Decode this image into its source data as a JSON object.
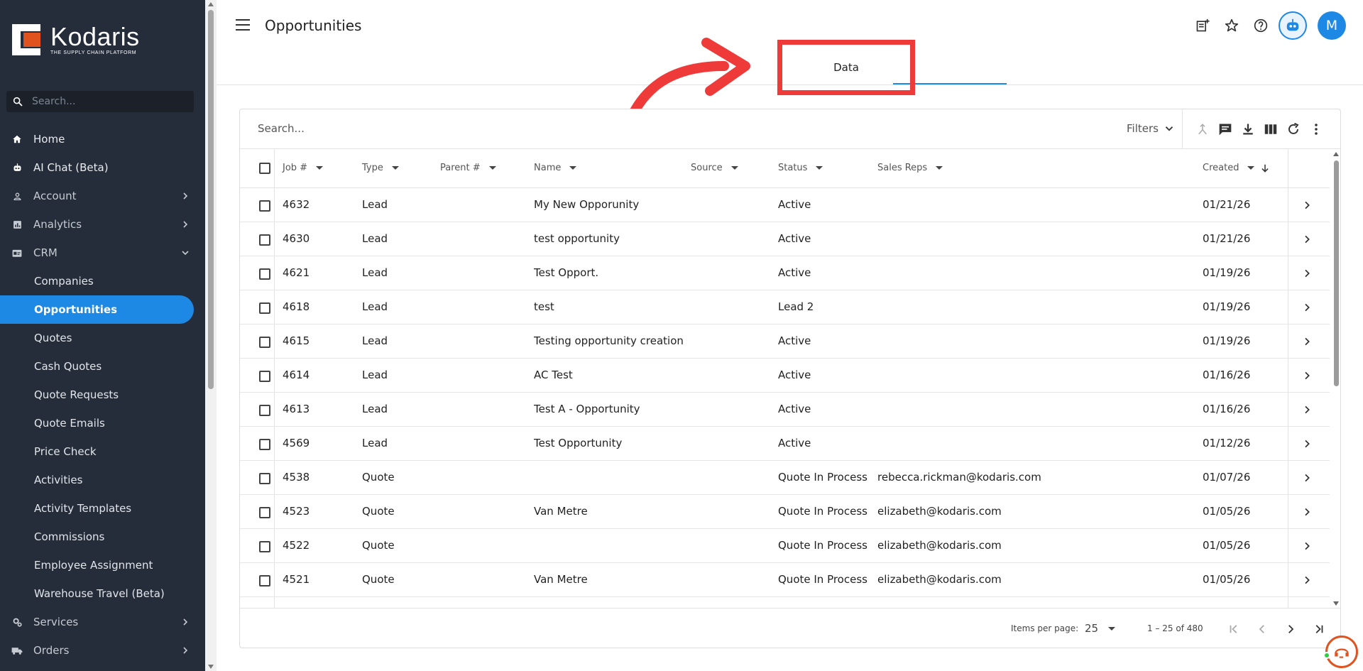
{
  "brand": {
    "name": "Kodaris",
    "tagline": "THE SUPPLY CHAIN PLATFORM",
    "accent": "#e0531f"
  },
  "sidebar": {
    "search_placeholder": "Search...",
    "items": [
      {
        "label": "Home",
        "icon": "home-icon"
      },
      {
        "label": "AI Chat (Beta)",
        "icon": "robot-icon"
      },
      {
        "label": "Account",
        "icon": "person-icon"
      },
      {
        "label": "Analytics",
        "icon": "chart-icon"
      },
      {
        "label": "CRM",
        "icon": "id-card-icon"
      }
    ],
    "crm_sub": [
      {
        "label": "Companies"
      },
      {
        "label": "Opportunities"
      },
      {
        "label": "Quotes"
      },
      {
        "label": "Cash Quotes"
      },
      {
        "label": "Quote Requests"
      },
      {
        "label": "Quote Emails"
      },
      {
        "label": "Price Check"
      },
      {
        "label": "Activities"
      },
      {
        "label": "Activity Templates"
      },
      {
        "label": "Commissions"
      },
      {
        "label": "Employee Assignment"
      },
      {
        "label": "Warehouse Travel (Beta)"
      }
    ],
    "bottom": [
      {
        "label": "Services",
        "icon": "gears-icon"
      },
      {
        "label": "Orders",
        "icon": "truck-icon"
      }
    ]
  },
  "header": {
    "title": "Opportunities",
    "avatar_initial": "M"
  },
  "tabs": {
    "data_label": "Data"
  },
  "toolbar": {
    "search_placeholder": "Search...",
    "filters_label": "Filters"
  },
  "table": {
    "columns": [
      "Job #",
      "Type",
      "Parent #",
      "Name",
      "Source",
      "Status",
      "Sales Reps",
      "Created"
    ],
    "rows": [
      {
        "job": "4632",
        "type": "Lead",
        "parent": "",
        "name": "My New Opporunity",
        "source": "",
        "status": "Active",
        "reps": "",
        "created": "01/21/26"
      },
      {
        "job": "4630",
        "type": "Lead",
        "parent": "",
        "name": "test opportunity",
        "source": "",
        "status": "Active",
        "reps": "",
        "created": "01/21/26"
      },
      {
        "job": "4621",
        "type": "Lead",
        "parent": "",
        "name": "Test Opport.",
        "source": "",
        "status": "Active",
        "reps": "",
        "created": "01/19/26"
      },
      {
        "job": "4618",
        "type": "Lead",
        "parent": "",
        "name": "test",
        "source": "",
        "status": "Lead 2",
        "reps": "",
        "created": "01/19/26"
      },
      {
        "job": "4615",
        "type": "Lead",
        "parent": "",
        "name": "Testing opportunity creation",
        "source": "",
        "status": "Active",
        "reps": "",
        "created": "01/19/26"
      },
      {
        "job": "4614",
        "type": "Lead",
        "parent": "",
        "name": "AC Test",
        "source": "",
        "status": "Active",
        "reps": "",
        "created": "01/16/26"
      },
      {
        "job": "4613",
        "type": "Lead",
        "parent": "",
        "name": "Test A - Opportunity",
        "source": "",
        "status": "Active",
        "reps": "",
        "created": "01/16/26"
      },
      {
        "job": "4569",
        "type": "Lead",
        "parent": "",
        "name": "Test Opportunity",
        "source": "",
        "status": "Active",
        "reps": "",
        "created": "01/12/26"
      },
      {
        "job": "4538",
        "type": "Quote",
        "parent": "",
        "name": "",
        "source": "",
        "status": "Quote In Process",
        "reps": "rebecca.rickman@kodaris.com",
        "created": "01/07/26"
      },
      {
        "job": "4523",
        "type": "Quote",
        "parent": "",
        "name": "Van Metre",
        "source": "",
        "status": "Quote In Process",
        "reps": "elizabeth@kodaris.com",
        "created": "01/05/26"
      },
      {
        "job": "4522",
        "type": "Quote",
        "parent": "",
        "name": "",
        "source": "",
        "status": "Quote In Process",
        "reps": "elizabeth@kodaris.com",
        "created": "01/05/26"
      },
      {
        "job": "4521",
        "type": "Quote",
        "parent": "",
        "name": "Van Metre",
        "source": "",
        "status": "Quote In Process",
        "reps": "elizabeth@kodaris.com",
        "created": "01/05/26"
      }
    ]
  },
  "paginator": {
    "items_label": "Items per page:",
    "page_size": "25",
    "range": "1 – 25 of 480"
  },
  "colors": {
    "primary": "#1e88e5",
    "sidebar_bg": "#262d3a",
    "annotation_red": "#ef3a3a"
  }
}
